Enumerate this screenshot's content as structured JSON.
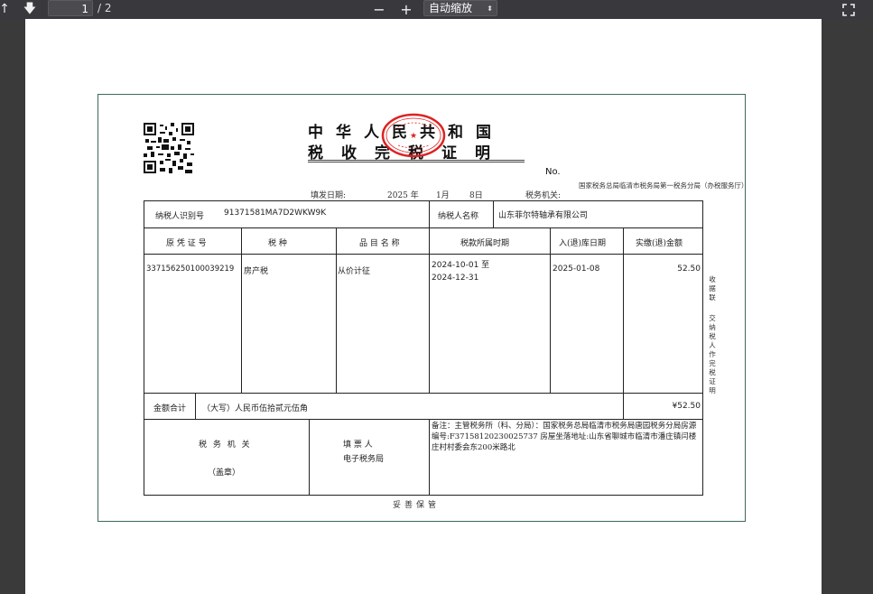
{
  "toolbar": {
    "page_current": "1",
    "page_total": "/ 2",
    "zoom_out_label": "−",
    "zoom_in_label": "+",
    "zoom_value": "自动缩放",
    "up_icon": "arrow-up-icon",
    "down_icon": "arrow-down-icon",
    "expand_icon": "fullscreen-icon"
  },
  "certificate": {
    "title_line1": "中华人民共和国",
    "title_line2": "税收完税证明",
    "no_label": "No.",
    "issue_date_label": "填发日期:",
    "issue_year": "2025 年",
    "issue_month": "1月",
    "issue_day": "8日",
    "tax_authority_label": "税务机关:",
    "tax_authority": "国家税务总局临清市税务局第一税务分局（办税服务厅）",
    "taxpayer_id_label": "纳税人识别号",
    "taxpayer_id": "91371581MA7D2WKW9K",
    "taxpayer_name_label": "纳税人名称",
    "taxpayer_name": "山东菲尔特轴承有限公司",
    "columns": [
      "原 凭 证 号",
      "税  种",
      "品 目 名 称",
      "税款所属时期",
      "入(退)库日期",
      "实缴(退)金额"
    ],
    "row": {
      "voucher_no": "337156250100039219",
      "tax_type": "房产税",
      "item_name": "从价计征",
      "period_start": "2024-10-01 至",
      "period_end": "2024-12-31",
      "storage_date": "2025-01-08",
      "amount": "52.50"
    },
    "total_label": "金额合计",
    "total_words": "（大写）人民币伍拾贰元伍角",
    "total_amount": "¥52.50",
    "tax_office_label": "税 务 机 关",
    "seal_label": "（盖章）",
    "filler_label": "填  票  人",
    "filler_value": "电子税务局",
    "remarks": "备注：主管税务所（科、分局）：国家税务总局临清市税务局唐园税务分局房源编号:F37158120230025737 房屋坐落地址:山东省聊城市临清市潘庄镇闫楼庄村村委会东200米路北",
    "side_note_1": "收据联",
    "side_note_2": "交纳税人作完税证明",
    "footer": "妥善保管"
  }
}
